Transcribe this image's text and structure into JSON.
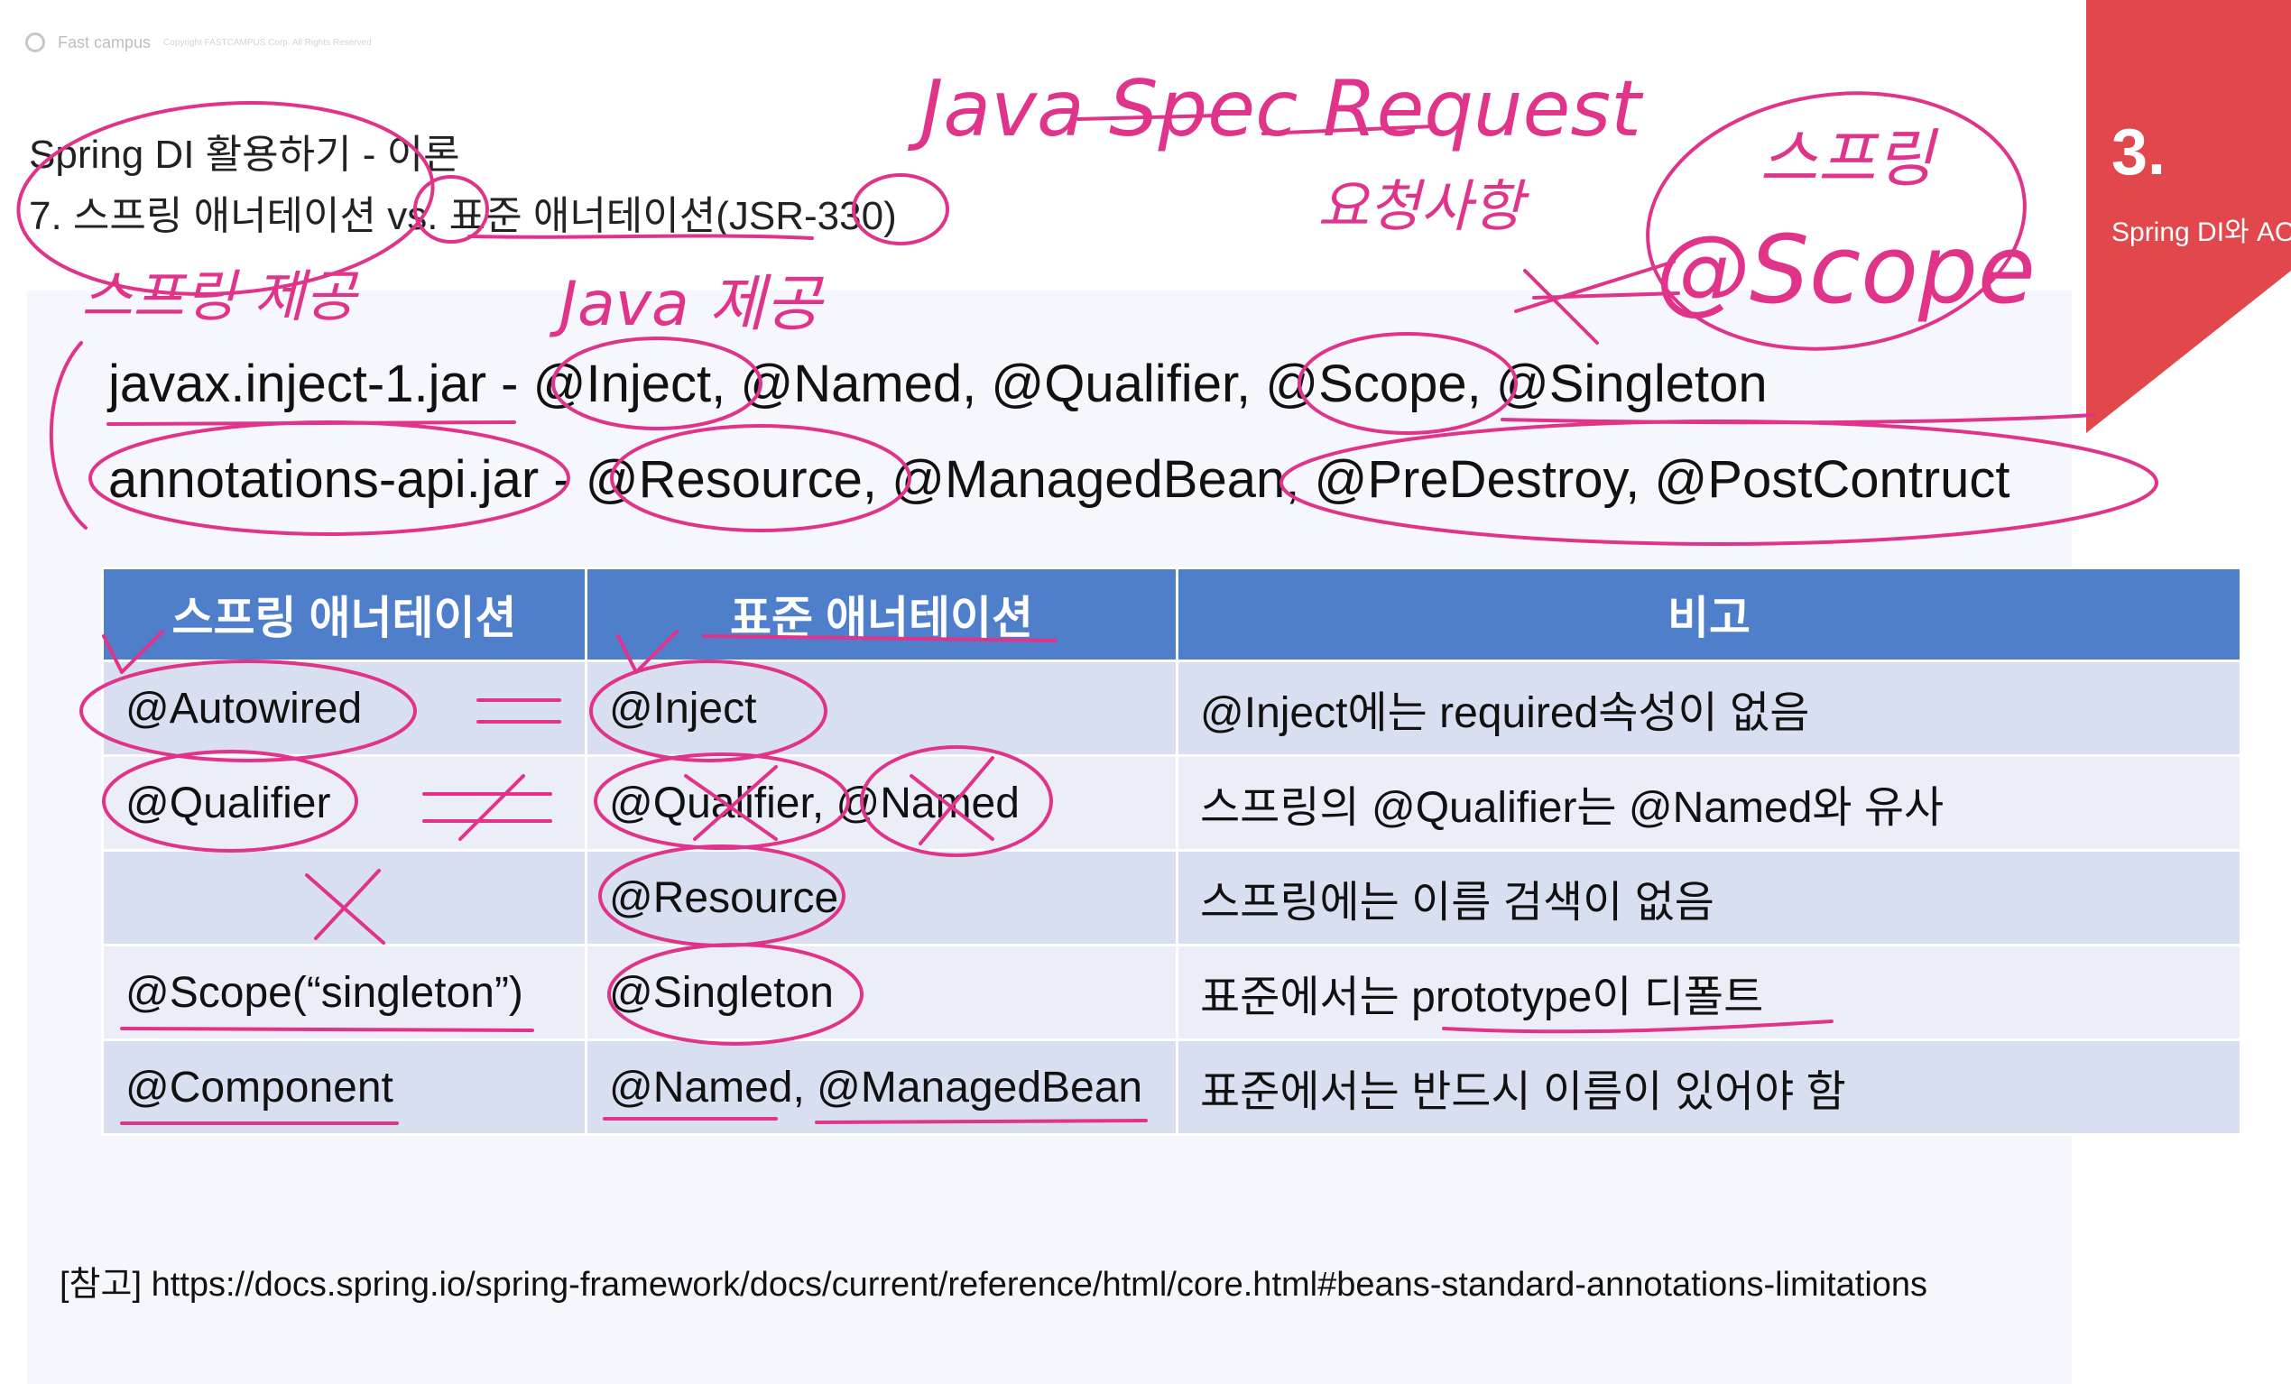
{
  "brand": {
    "name": "Fast campus",
    "copyright": "Copyright FASTCAMPUS Corp. All Rights Reserved"
  },
  "slide": {
    "title": "Spring DI 활용하기 - 이론",
    "subtitle": "7. 스프링 애너테이션 vs. 표준 애너테이션(JSR-330)"
  },
  "banner": {
    "number": "3.",
    "subtitle": "Spring DI와 AOP"
  },
  "libraries": [
    "javax.inject-1.jar - @Inject, @Named, @Qualifier, @Scope, @Singleton",
    "annotations-api.jar - @Resource, @ManagedBean, @PreDestroy, @PostContruct"
  ],
  "table": {
    "headers": [
      "스프링 애너테이션",
      "표준 애너테이션",
      "비고"
    ],
    "rows": [
      [
        "@Autowired",
        "@Inject",
        "@Inject에는 required속성이 없음"
      ],
      [
        "@Qualifier",
        "@Qualifier, @Named",
        "스프링의 @Qualifier는 @Named와 유사"
      ],
      [
        "",
        "@Resource",
        "스프링에는 이름 검색이 없음"
      ],
      [
        "@Scope(“singleton”)",
        "@Singleton",
        "표준에서는 prototype이 디폴트"
      ],
      [
        "@Component",
        "@Named, @ManagedBean",
        "표준에서는 반드시 이름이 있어야 함"
      ]
    ]
  },
  "reference": "[참고] https://docs.spring.io/spring-framework/docs/current/reference/html/core.html#beans-standard-annotations-limitations",
  "handwriting": {
    "java_spec_request": "Java Spec Request",
    "requirements": "요청사항",
    "spring_scope_label": "스프링",
    "spring_scope": "@Scope",
    "spring_provided": "스프링 제공",
    "java_provided": "Java 제공"
  },
  "colors": {
    "banner": "#e2474b",
    "table_header": "#4f7fcb",
    "row_odd": "#d8dff0",
    "row_even": "#ebeef7",
    "pen": "#e0338a"
  }
}
